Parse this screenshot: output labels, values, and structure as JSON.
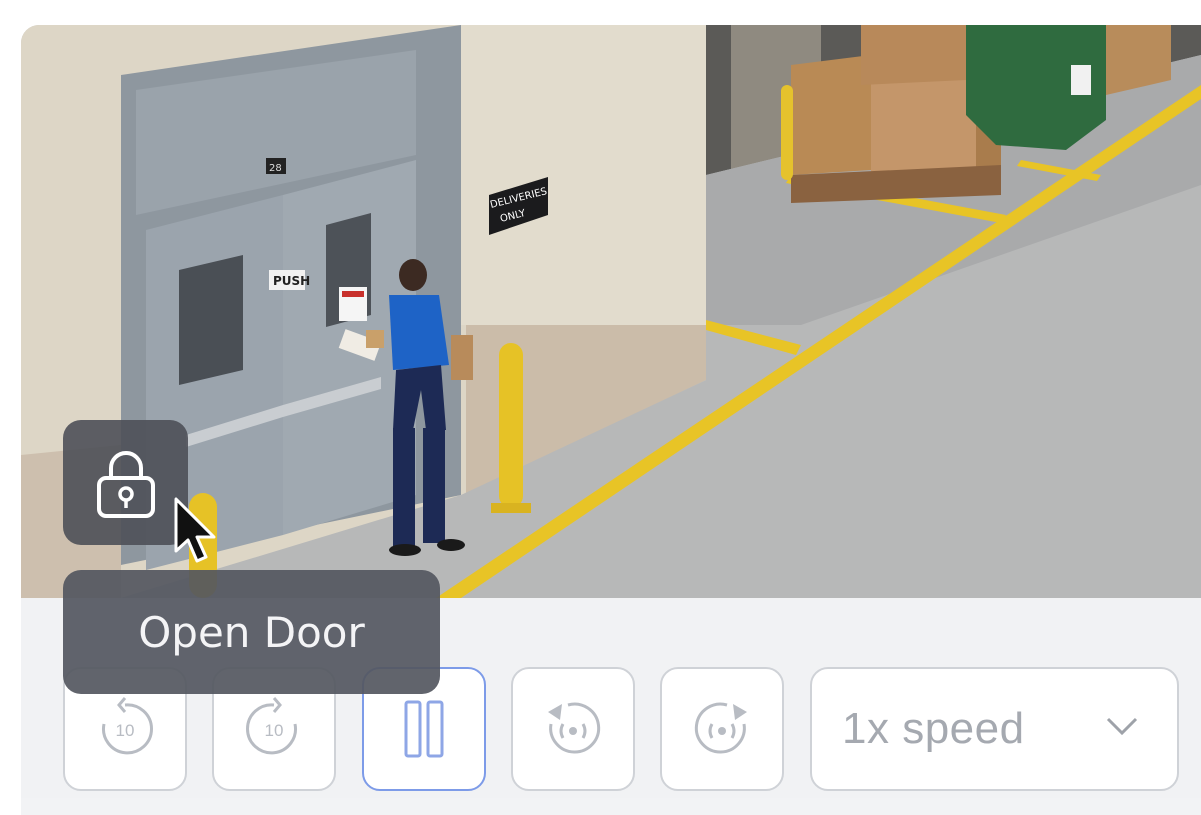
{
  "video": {
    "scene_signs": {
      "door_number": "28",
      "push_sign": "PUSH",
      "delivery_sign_line1": "DELIVERIES",
      "delivery_sign_line2": "ONLY"
    }
  },
  "controls": {
    "rewind_label": "10",
    "forward_label": "10",
    "speed_value": "1x speed"
  },
  "overlay": {
    "lock_icon": "lock-icon",
    "tooltip_text": "Open Door"
  },
  "colors": {
    "active_border": "#7d9be8",
    "icon_gray": "#b8bcc3",
    "tooltip_bg": "#545760"
  }
}
